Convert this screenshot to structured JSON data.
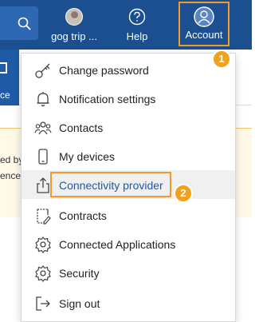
{
  "header": {
    "trip_label": "gog trip ...",
    "help_label": "Help",
    "account_label": "Account",
    "partial_nav_text": "ce"
  },
  "notice": {
    "line1": "ed by",
    "line2": "ences"
  },
  "menu": {
    "items": [
      {
        "label": "Change password",
        "icon": "key-icon"
      },
      {
        "label": "Notification settings",
        "icon": "bell-icon"
      },
      {
        "label": "Contacts",
        "icon": "contacts-icon"
      },
      {
        "label": "My devices",
        "icon": "phone-icon"
      },
      {
        "label": "Connectivity provider",
        "icon": "share-icon",
        "highlighted": true
      },
      {
        "label": "Contracts",
        "icon": "contract-icon"
      },
      {
        "label": "Connected Applications",
        "icon": "gear-icon"
      },
      {
        "label": "Security",
        "icon": "gear-icon"
      },
      {
        "label": "Sign out",
        "icon": "sign-out-icon"
      }
    ]
  },
  "callouts": {
    "badge1": "1",
    "badge2": "2"
  },
  "colors": {
    "topbar": "#1b4f8f",
    "accent_orange": "#f39a2b",
    "badge": "#f0a21f",
    "link_blue": "#1f5aa6"
  }
}
